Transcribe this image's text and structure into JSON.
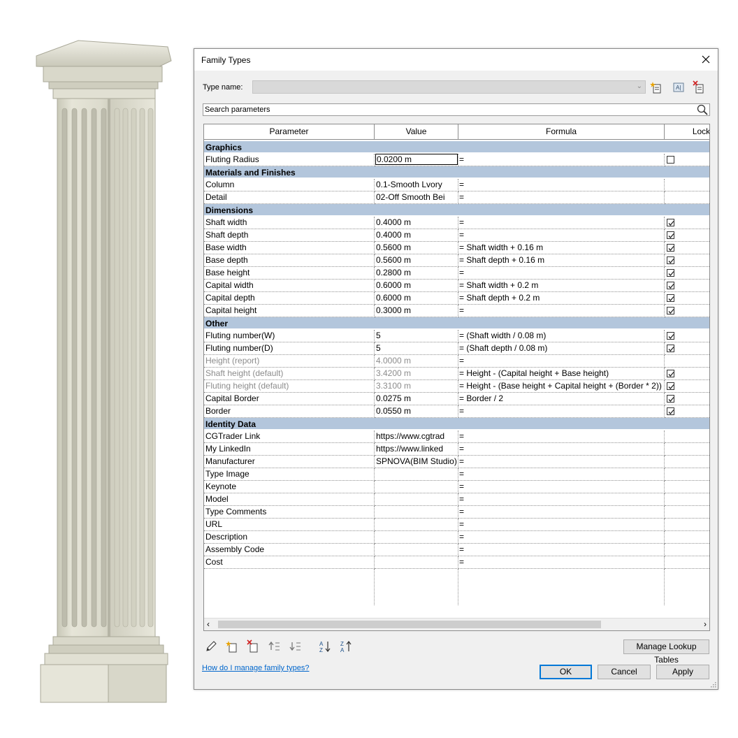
{
  "dialog": {
    "title": "Family Types",
    "type_name_label": "Type name:",
    "type_name_value": "",
    "search_placeholder": "Search parameters",
    "columns": [
      "Parameter",
      "Value",
      "Formula",
      "Lock"
    ],
    "groups": [
      {
        "name": "Graphics",
        "rows": [
          {
            "name": "Fluting Radius",
            "value": "0.0200 m",
            "formula": "=",
            "lock": "unchecked",
            "editing": true
          }
        ]
      },
      {
        "name": "Materials and Finishes",
        "rows": [
          {
            "name": "Column",
            "value": "0.1-Smooth Lvory",
            "formula": "=",
            "lock": "none"
          },
          {
            "name": "Detail",
            "value": "02-Off Smooth Bei",
            "formula": "=",
            "lock": "none"
          }
        ]
      },
      {
        "name": "Dimensions",
        "rows": [
          {
            "name": "Shaft width",
            "value": "0.4000 m",
            "formula": "=",
            "lock": "checked"
          },
          {
            "name": "Shaft depth",
            "value": "0.4000 m",
            "formula": "=",
            "lock": "checked"
          },
          {
            "name": "Base width",
            "value": "0.5600 m",
            "formula": "= Shaft width + 0.16 m",
            "lock": "checked"
          },
          {
            "name": "Base depth",
            "value": "0.5600 m",
            "formula": "= Shaft depth + 0.16 m",
            "lock": "checked"
          },
          {
            "name": "Base height",
            "value": "0.2800 m",
            "formula": "=",
            "lock": "checked"
          },
          {
            "name": "Capital width",
            "value": "0.6000 m",
            "formula": "= Shaft width + 0.2 m",
            "lock": "checked"
          },
          {
            "name": "Capital depth",
            "value": "0.6000 m",
            "formula": "= Shaft depth + 0.2 m",
            "lock": "checked"
          },
          {
            "name": "Capital height",
            "value": "0.3000 m",
            "formula": "=",
            "lock": "checked"
          }
        ]
      },
      {
        "name": "Other",
        "rows": [
          {
            "name": "Fluting number(W)",
            "value": "5",
            "formula": "= (Shaft width / 0.08 m)",
            "lock": "checked"
          },
          {
            "name": "Fluting number(D)",
            "value": "5",
            "formula": "= (Shaft depth / 0.08 m)",
            "lock": "checked"
          },
          {
            "name": "Height (report)",
            "value": "4.0000 m",
            "formula": "=",
            "lock": "none",
            "gray": true
          },
          {
            "name": "Shaft height (default)",
            "value": "3.4200 m",
            "formula": "= Height - (Capital height + Base height)",
            "lock": "checked",
            "gray": true
          },
          {
            "name": "Fluting height (default)",
            "value": "3.3100 m",
            "formula": "= Height - (Base height + Capital height + (Border * 2))",
            "lock": "checked",
            "gray": true
          },
          {
            "name": "Capital Border",
            "value": "0.0275 m",
            "formula": "= Border / 2",
            "lock": "checked"
          },
          {
            "name": "Border",
            "value": "0.0550 m",
            "formula": "=",
            "lock": "checked"
          }
        ]
      },
      {
        "name": "Identity Data",
        "rows": [
          {
            "name": "CGTrader Link",
            "value": "https://www.cgtrad",
            "formula": "=",
            "lock": "none"
          },
          {
            "name": "My LinkedIn",
            "value": "https://www.linked",
            "formula": "=",
            "lock": "none"
          },
          {
            "name": "Manufacturer",
            "value": "SPNOVA(BIM Studio)",
            "formula": "=",
            "lock": "none"
          },
          {
            "name": "Type Image",
            "value": "",
            "formula": "=",
            "lock": "none"
          },
          {
            "name": "Keynote",
            "value": "",
            "formula": "=",
            "lock": "none"
          },
          {
            "name": "Model",
            "value": "",
            "formula": "=",
            "lock": "none"
          },
          {
            "name": "Type Comments",
            "value": "",
            "formula": "=",
            "lock": "none"
          },
          {
            "name": "URL",
            "value": "",
            "formula": "=",
            "lock": "none"
          },
          {
            "name": "Description",
            "value": "",
            "formula": "=",
            "lock": "none"
          },
          {
            "name": "Assembly Code",
            "value": "",
            "formula": "=",
            "lock": "none"
          },
          {
            "name": "Cost",
            "value": "",
            "formula": "=",
            "lock": "none"
          }
        ]
      }
    ],
    "buttons": {
      "manage_lookup": "Manage Lookup Tables",
      "ok": "OK",
      "cancel": "Cancel",
      "apply": "Apply"
    },
    "help_link": "How do I manage family types?",
    "group_color": "#b3c6dc",
    "accent": "#0078d7"
  }
}
